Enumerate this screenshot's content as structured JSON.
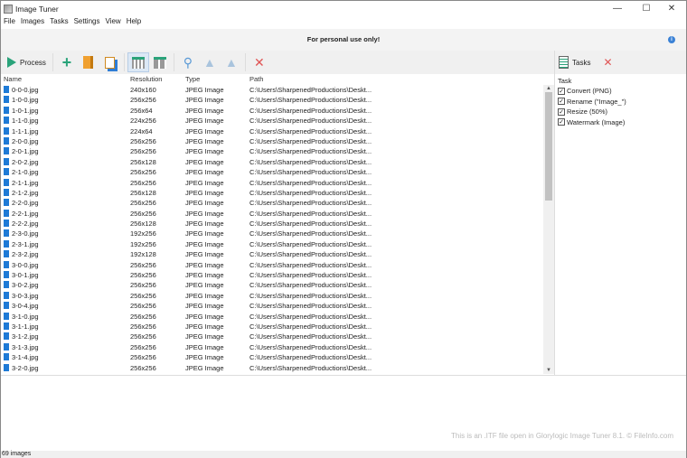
{
  "window": {
    "title": "Image Tuner",
    "minimize": "—",
    "maximize": "☐",
    "close": "✕"
  },
  "menu": [
    "File",
    "Images",
    "Tasks",
    "Settings",
    "View",
    "Help"
  ],
  "banner": {
    "text": "For personal use only!",
    "info": "i"
  },
  "toolbar": {
    "process_label": "Process"
  },
  "columns": [
    "Name",
    "Resolution",
    "Type",
    "Path"
  ],
  "rows": [
    [
      "0-0-0.jpg",
      "240x160",
      "JPEG Image",
      "C:\\Users\\SharpenedProductions\\Deskt..."
    ],
    [
      "1-0-0.jpg",
      "256x256",
      "JPEG Image",
      "C:\\Users\\SharpenedProductions\\Deskt..."
    ],
    [
      "1-0-1.jpg",
      "256x64",
      "JPEG Image",
      "C:\\Users\\SharpenedProductions\\Deskt..."
    ],
    [
      "1-1-0.jpg",
      "224x256",
      "JPEG Image",
      "C:\\Users\\SharpenedProductions\\Deskt..."
    ],
    [
      "1-1-1.jpg",
      "224x64",
      "JPEG Image",
      "C:\\Users\\SharpenedProductions\\Deskt..."
    ],
    [
      "2-0-0.jpg",
      "256x256",
      "JPEG Image",
      "C:\\Users\\SharpenedProductions\\Deskt..."
    ],
    [
      "2-0-1.jpg",
      "256x256",
      "JPEG Image",
      "C:\\Users\\SharpenedProductions\\Deskt..."
    ],
    [
      "2-0-2.jpg",
      "256x128",
      "JPEG Image",
      "C:\\Users\\SharpenedProductions\\Deskt..."
    ],
    [
      "2-1-0.jpg",
      "256x256",
      "JPEG Image",
      "C:\\Users\\SharpenedProductions\\Deskt..."
    ],
    [
      "2-1-1.jpg",
      "256x256",
      "JPEG Image",
      "C:\\Users\\SharpenedProductions\\Deskt..."
    ],
    [
      "2-1-2.jpg",
      "256x128",
      "JPEG Image",
      "C:\\Users\\SharpenedProductions\\Deskt..."
    ],
    [
      "2-2-0.jpg",
      "256x256",
      "JPEG Image",
      "C:\\Users\\SharpenedProductions\\Deskt..."
    ],
    [
      "2-2-1.jpg",
      "256x256",
      "JPEG Image",
      "C:\\Users\\SharpenedProductions\\Deskt..."
    ],
    [
      "2-2-2.jpg",
      "256x128",
      "JPEG Image",
      "C:\\Users\\SharpenedProductions\\Deskt..."
    ],
    [
      "2-3-0.jpg",
      "192x256",
      "JPEG Image",
      "C:\\Users\\SharpenedProductions\\Deskt..."
    ],
    [
      "2-3-1.jpg",
      "192x256",
      "JPEG Image",
      "C:\\Users\\SharpenedProductions\\Deskt..."
    ],
    [
      "2-3-2.jpg",
      "192x128",
      "JPEG Image",
      "C:\\Users\\SharpenedProductions\\Deskt..."
    ],
    [
      "3-0-0.jpg",
      "256x256",
      "JPEG Image",
      "C:\\Users\\SharpenedProductions\\Deskt..."
    ],
    [
      "3-0-1.jpg",
      "256x256",
      "JPEG Image",
      "C:\\Users\\SharpenedProductions\\Deskt..."
    ],
    [
      "3-0-2.jpg",
      "256x256",
      "JPEG Image",
      "C:\\Users\\SharpenedProductions\\Deskt..."
    ],
    [
      "3-0-3.jpg",
      "256x256",
      "JPEG Image",
      "C:\\Users\\SharpenedProductions\\Deskt..."
    ],
    [
      "3-0-4.jpg",
      "256x256",
      "JPEG Image",
      "C:\\Users\\SharpenedProductions\\Deskt..."
    ],
    [
      "3-1-0.jpg",
      "256x256",
      "JPEG Image",
      "C:\\Users\\SharpenedProductions\\Deskt..."
    ],
    [
      "3-1-1.jpg",
      "256x256",
      "JPEG Image",
      "C:\\Users\\SharpenedProductions\\Deskt..."
    ],
    [
      "3-1-2.jpg",
      "256x256",
      "JPEG Image",
      "C:\\Users\\SharpenedProductions\\Deskt..."
    ],
    [
      "3-1-3.jpg",
      "256x256",
      "JPEG Image",
      "C:\\Users\\SharpenedProductions\\Deskt..."
    ],
    [
      "3-1-4.jpg",
      "256x256",
      "JPEG Image",
      "C:\\Users\\SharpenedProductions\\Deskt..."
    ],
    [
      "3-2-0.jpg",
      "256x256",
      "JPEG Image",
      "C:\\Users\\SharpenedProductions\\Deskt..."
    ]
  ],
  "tasks_panel": {
    "button_label": "Tasks",
    "header": "Task",
    "items": [
      "Convert (PNG)",
      "Rename (\"Image_\")",
      "Resize (50%)",
      "Watermark (Image)"
    ]
  },
  "watermark": "This is an .ITF file open in Glorylogic Image Tuner 8.1. © FileInfo.com",
  "status": "69 images"
}
